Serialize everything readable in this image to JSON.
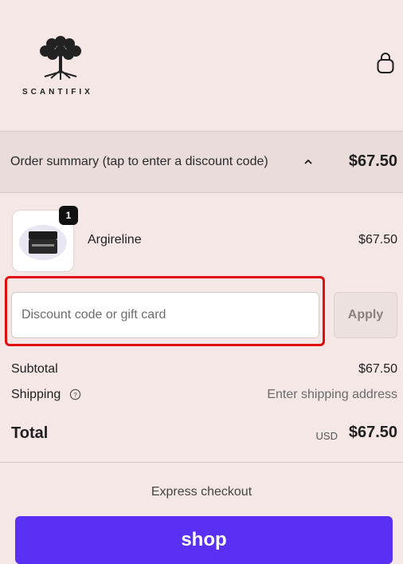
{
  "header": {
    "brand": "SCANTIFIX",
    "icons": {
      "logo": "tree-logo-icon",
      "cart": "shopping-bag-icon"
    }
  },
  "summary": {
    "label": "Order summary (tap to enter a discount code)",
    "total": "$67.50",
    "toggle_icon": "chevron-up-icon"
  },
  "product": {
    "name": "Argireline",
    "price": "$67.50",
    "quantity": "1"
  },
  "discount": {
    "placeholder": "Discount code or gift card",
    "value": "",
    "apply_label": "Apply"
  },
  "totals": {
    "subtotal_label": "Subtotal",
    "subtotal_value": "$67.50",
    "shipping_label": "Shipping",
    "shipping_value": "Enter shipping address",
    "total_label": "Total",
    "currency": "USD",
    "total_value": "$67.50"
  },
  "express": {
    "label": "Express checkout",
    "shop_label": "shop"
  },
  "colors": {
    "background": "#f4e7e5",
    "summary_bg": "#eadcda",
    "shop_accent": "#5a31f4",
    "highlight": "#e01010"
  }
}
